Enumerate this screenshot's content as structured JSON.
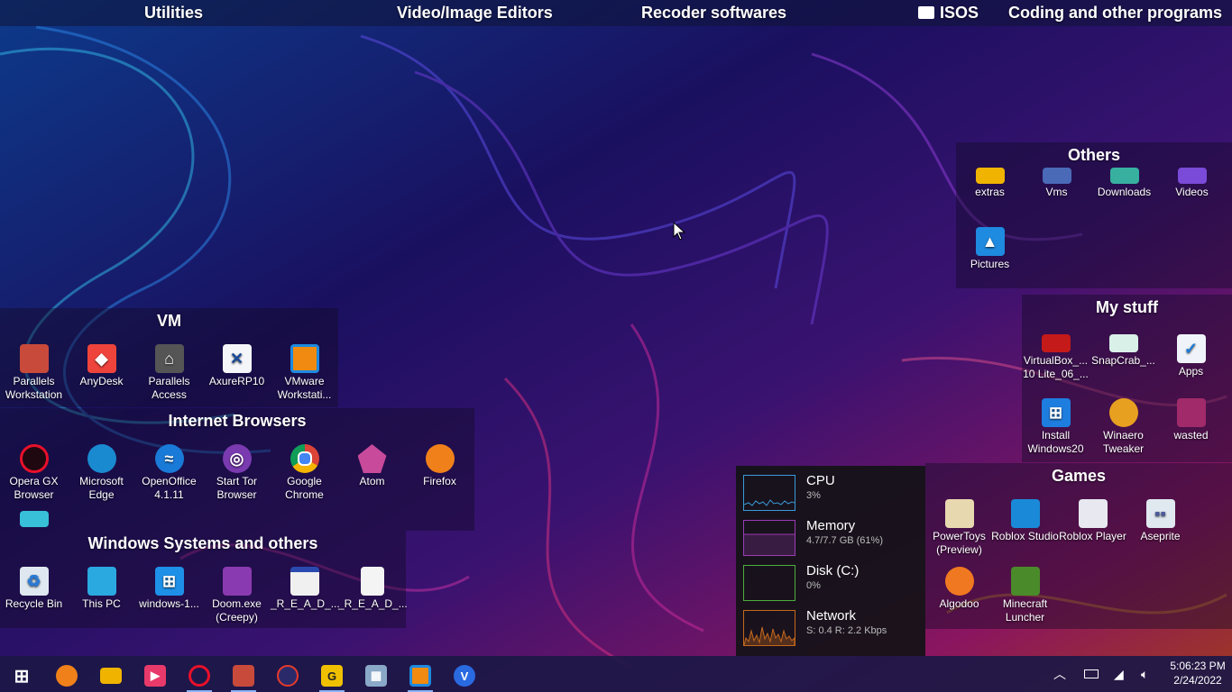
{
  "top_bar": {
    "items": [
      "Utilities",
      "Video/Image Editors",
      "Recoder softwares",
      "ISOS",
      "Coding and other programs"
    ]
  },
  "fences": {
    "others": {
      "title": "Others",
      "items": [
        {
          "label": "extras",
          "icon": "folder-icon"
        },
        {
          "label": "Vms",
          "icon": "vm-folder-icon"
        },
        {
          "label": "Downloads",
          "icon": "downloads-shortcut-icon"
        },
        {
          "label": "Videos",
          "icon": "videos-shortcut-icon"
        },
        {
          "label": "Pictures",
          "icon": "pictures-shortcut-icon"
        }
      ]
    },
    "my_stuff": {
      "title": "My stuff",
      "items": [
        {
          "label": "VirtualBox_... 10 Lite_06_...",
          "icon": "virtualbox-file-icon"
        },
        {
          "label": "SnapCrab_...",
          "icon": "snapcrab-icon"
        },
        {
          "label": "Apps",
          "icon": "apps-shortcut-icon"
        },
        {
          "label": "Install Windows20",
          "icon": "windows-installer-icon"
        },
        {
          "label": "Winaero Tweaker",
          "icon": "winaero-icon"
        },
        {
          "label": "wasted",
          "icon": "winrar-archive-icon"
        }
      ]
    },
    "games": {
      "title": "Games",
      "items": [
        {
          "label": "PowerToys (Preview)",
          "icon": "powertoys-icon"
        },
        {
          "label": "Roblox Studio",
          "icon": "roblox-studio-icon"
        },
        {
          "label": "Roblox Player",
          "icon": "roblox-player-icon"
        },
        {
          "label": "Aseprite",
          "icon": "aseprite-icon"
        },
        {
          "label": "Algodoo",
          "icon": "algodoo-icon"
        },
        {
          "label": "Minecraft Luncher",
          "icon": "minecraft-icon"
        }
      ]
    },
    "vm": {
      "title": "VM",
      "items": [
        {
          "label": "Parallels Workstation",
          "icon": "parallels-workstation-icon"
        },
        {
          "label": "AnyDesk",
          "icon": "anydesk-icon"
        },
        {
          "label": "Parallels Access",
          "icon": "parallels-access-icon"
        },
        {
          "label": "AxureRP10",
          "icon": "axure-icon"
        },
        {
          "label": "VMware Workstati...",
          "icon": "vmware-icon"
        }
      ]
    },
    "browsers": {
      "title": "Internet Browsers",
      "items": [
        {
          "label": "Opera GX Browser",
          "icon": "opera-gx-icon"
        },
        {
          "label": "Microsoft Edge",
          "icon": "edge-icon"
        },
        {
          "label": "OpenOffice 4.1.11",
          "icon": "openoffice-icon"
        },
        {
          "label": "Start Tor Browser",
          "icon": "tor-icon"
        },
        {
          "label": "Google Chrome",
          "icon": "chrome-icon"
        },
        {
          "label": "Atom",
          "icon": "atom-icon"
        },
        {
          "label": "Firefox",
          "icon": "firefox-icon"
        },
        {
          "label": "",
          "icon": "unknown-app-icon"
        }
      ]
    },
    "windows": {
      "title": "Windows Systems and others",
      "items": [
        {
          "label": "Recycle Bin",
          "icon": "recycle-bin-icon"
        },
        {
          "label": "This PC",
          "icon": "this-pc-icon"
        },
        {
          "label": "windows-1...",
          "icon": "windows-logo-icon"
        },
        {
          "label": "Doom.exe (Creepy)",
          "icon": "doom-exe-icon"
        },
        {
          "label": "_R_E_A_D_...",
          "icon": "window-file-icon"
        },
        {
          "label": "_R_E_A_D_...",
          "icon": "text-file-icon"
        }
      ]
    }
  },
  "performance": {
    "rows": [
      {
        "name": "CPU",
        "value": "3%",
        "color": "#3a9ad9",
        "level": 0.03
      },
      {
        "name": "Memory",
        "value": "4.7/7.7 GB (61%)",
        "color": "#9b3bb5",
        "level": 0.61
      },
      {
        "name": "Disk (C:)",
        "value": "0%",
        "color": "#4cae3c",
        "level": 0.0
      },
      {
        "name": "Network",
        "value": "S: 0.4 R: 2.2 Kbps",
        "color": "#c4681c",
        "level": 0.3
      }
    ]
  },
  "taskbar": {
    "apps": [
      {
        "icon": "windows-start-icon"
      },
      {
        "icon": "firefox-icon"
      },
      {
        "icon": "file-explorer-icon"
      },
      {
        "icon": "media-player-icon"
      },
      {
        "icon": "opera-gx-icon"
      },
      {
        "icon": "parallels-workstation-icon"
      },
      {
        "icon": "app-icon"
      },
      {
        "icon": "guardian-icon"
      },
      {
        "icon": "calculator-icon"
      },
      {
        "icon": "vmware-icon"
      },
      {
        "icon": "vivaldi-icon"
      }
    ],
    "time": "5:06:23 PM",
    "date": "2/24/2022"
  },
  "colors": {
    "taskbar_bg": "#1c1846",
    "accent": "#8ab4f8"
  }
}
